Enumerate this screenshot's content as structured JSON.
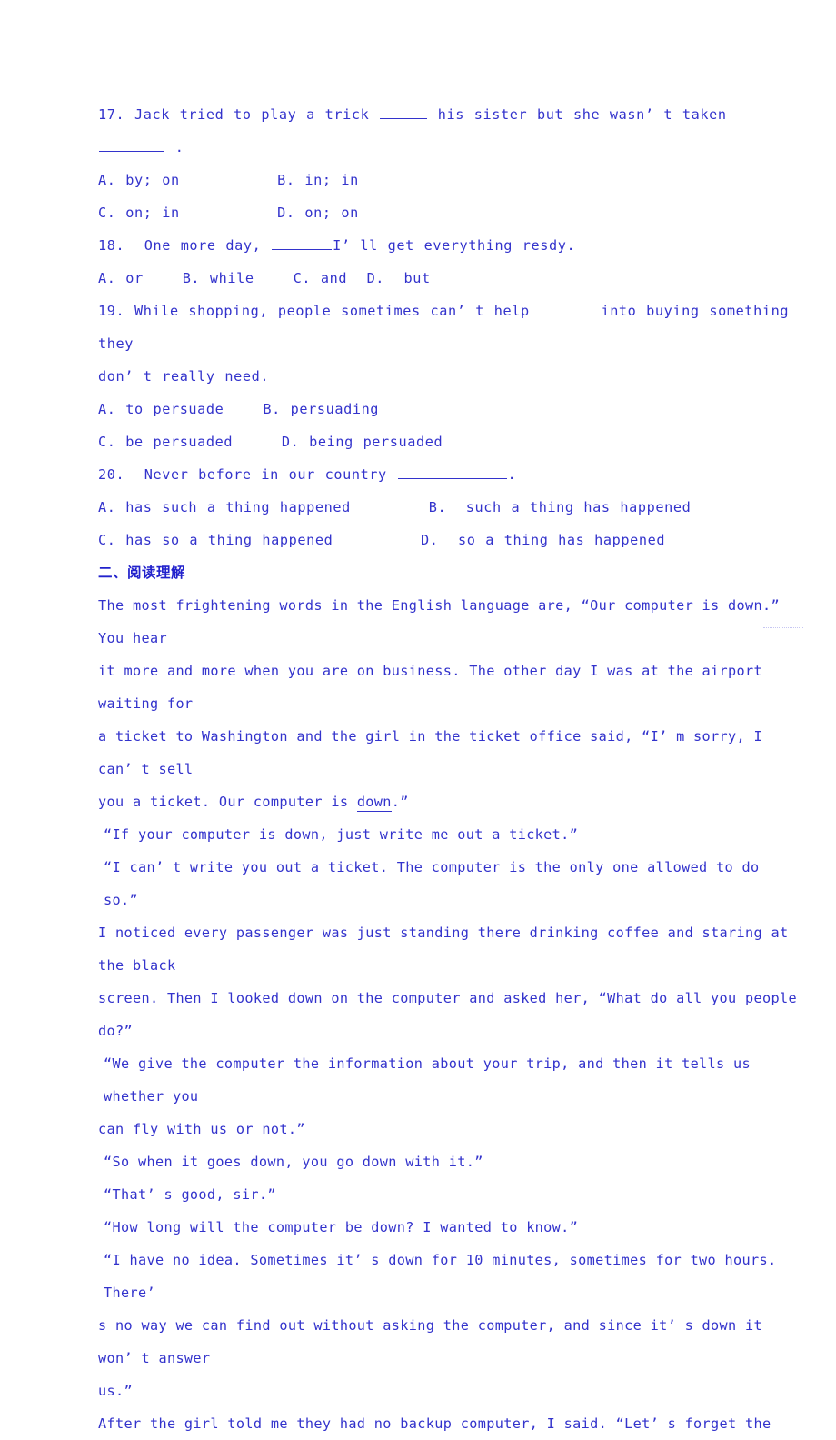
{
  "document": {
    "text_color": "#3333CC",
    "header_color": "#2222CC",
    "background": "#FFFFFF"
  },
  "grammar_section": {
    "questions": [
      {
        "number": "17.",
        "stem_before": "17. Jack tried to play a trick ",
        "stem_middle": " his sister but she wasn’ t taken ",
        "stem_after": " .",
        "full_stem": "17. Jack tried to play a trick _____ his sister but she wasn’ t taken ______ .",
        "options_row1": "A. by; on          B. in; in",
        "options_row2": "C. on; in          D. on; on",
        "option_a": "A. by; on",
        "option_b": "B. in; in",
        "option_c": "C. on; in",
        "option_d": "D. on; on"
      },
      {
        "number": "18.",
        "stem_before": "18.  One more day, ",
        "stem_after": "I’ ll get everything resdy.",
        "full_stem": "18.  One more day, ________I’ ll get everything resdy.",
        "options_row1": "A. or    B. while    C. and  D.  but",
        "option_a": "A. or",
        "option_b": "B. while",
        "option_c": "C. and",
        "option_d": "D.  but"
      },
      {
        "number": "19.",
        "stem_before": "19. While shopping, people sometimes can’ t help",
        "stem_after": " into buying something they",
        "stem_line2": "don’ t really need.",
        "full_stem": "19. While shopping, people sometimes can’ t help_______ into buying something they don’ t really need.",
        "options_row1": "A. to persuade    B. persuading",
        "options_row2": "C. be persuaded     D. being persuaded",
        "option_a": "A. to persuade",
        "option_b": "B. persuading",
        "option_c": "C. be persuaded",
        "option_d": "D. being persuaded"
      },
      {
        "number": "20.",
        "stem_before": "20.  Never before in our country ",
        "stem_after": ".",
        "full_stem": "20.  Never before in our country _____________.",
        "options_row1": "A. has such a thing happened        B.  such a thing has happened",
        "options_row2": "C. has so a thing happened         D.  so a thing has happened",
        "option_a": "A. has such a thing happened",
        "option_b": "B.  such a thing has happened",
        "option_c": "C. has so a thing happened",
        "option_d": "D.  so a thing has happened"
      }
    ]
  },
  "reading_section": {
    "header": "二、阅读理解",
    "passage_lines": [
      {
        "text": "The most frightening words in the English language are, “Our computer is down.” You hear",
        "indent": false,
        "underline_word": null
      },
      {
        "text": "it more and more when you are on business. The other day I was at the airport waiting for",
        "indent": false,
        "underline_word": null
      },
      {
        "text": "a ticket to Washington and the girl in the ticket office said, “I’ m sorry, I can’ t sell",
        "indent": false,
        "underline_word": null
      },
      {
        "text": "you a ticket. Our computer is down.”",
        "indent": false,
        "underline_word": "down"
      },
      {
        "text": "“If your computer is down, just write me out a ticket.”",
        "indent": true,
        "underline_word": null
      },
      {
        "text": "“I can’ t write you out a ticket. The computer is the only one allowed to do so.”",
        "indent": true,
        "underline_word": null
      },
      {
        "text": "I noticed every passenger was just standing there drinking coffee and staring at the black",
        "indent": false,
        "underline_word": null
      },
      {
        "text": "screen. Then I looked down on the computer and asked her, “What do all you people do?”",
        "indent": false,
        "underline_word": null
      },
      {
        "text": "“We give the computer the information about your trip, and then it tells us whether you",
        "indent": true,
        "underline_word": null
      },
      {
        "text": "can fly with us or not.”",
        "indent": false,
        "underline_word": null
      },
      {
        "text": "“So when it goes down, you go down with it.”",
        "indent": true,
        "underline_word": null
      },
      {
        "text": "“That’ s good, sir.”",
        "indent": true,
        "underline_word": null
      },
      {
        "text": "“How long will the computer be down? I wanted to know.”",
        "indent": true,
        "underline_word": null
      },
      {
        "text": "“I have no idea. Sometimes it’ s down for 10 minutes, sometimes for two hours. There’",
        "indent": true,
        "underline_word": null
      },
      {
        "text": "s no way we can find out without asking the computer, and since it’ s down it won’ t answer",
        "indent": false,
        "underline_word": null
      },
      {
        "text": "us.”",
        "indent": false,
        "underline_word": null
      },
      {
        "text": "After the girl told me they had no backup computer, I said. “Let’ s forget the",
        "indent": false,
        "underline_word": null
      }
    ],
    "underlined_term": "down"
  }
}
